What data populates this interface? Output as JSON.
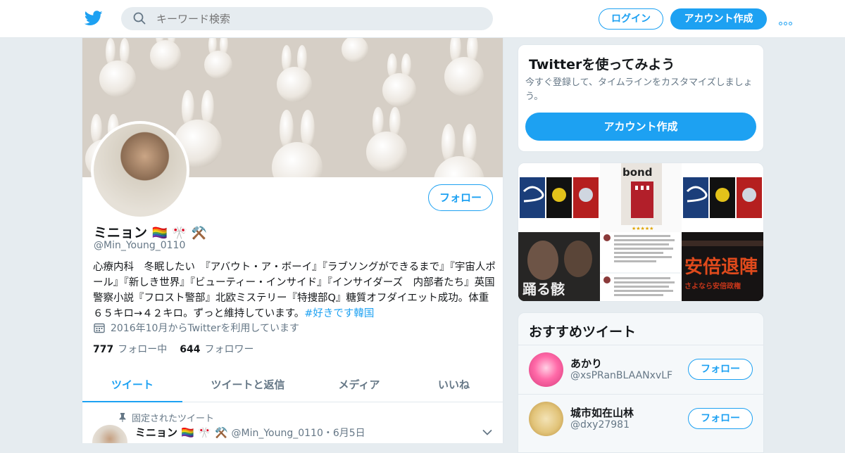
{
  "topbar": {
    "search_placeholder": "キーワード検索",
    "login_label": "ログイン",
    "signup_label": "アカウント作成"
  },
  "profile": {
    "display_name": "ミニョン",
    "name_emoji": "🏳️‍🌈 🎌 ⚒️",
    "handle": "@Min_Young_0110",
    "follow_label": "フォロー",
    "bio_text": "心療内科　冬眠したい　『アバウト・ア・ボーイ』『ラブソングができるまで』『宇宙人ポール』『新しき世界』『ビューティー・インサイド』『インサイダーズ　内部者たち』英国警察小説『フロスト警部』北欧ミステリー『特捜部Q』糖質オフダイエット成功。体重６５キロ→４２キロ。ずっと維持しています。",
    "bio_hashtag": "#好きです韓国",
    "joined": "2016年10月からTwitterを利用しています",
    "following_count": "777",
    "following_label": "フォロー中",
    "followers_count": "644",
    "followers_label": "フォロワー",
    "tabs": [
      {
        "label": "ツイート"
      },
      {
        "label": "ツイートと返信"
      },
      {
        "label": "メディア"
      },
      {
        "label": "いいね"
      }
    ],
    "pinned_label": "固定されたツイート",
    "pinned_tweet": {
      "name": "ミニョン 🏳️‍🌈 🎌 ⚒️",
      "meta": "@Min_Young_0110・6月5日"
    }
  },
  "try_card": {
    "title": "Twitterを使ってみよう",
    "description": "今すぐ登録して、タイムラインをカスタマイズしましょう。",
    "button_label": "アカウント作成"
  },
  "media": {
    "tile_texts": [
      "bond",
      "踊る骸",
      "安倍退陣",
      "さよなら安倍政権"
    ]
  },
  "recommended": {
    "title": "おすすめツイート",
    "follow_label": "フォロー",
    "accounts": [
      {
        "name": "あかり",
        "handle": "@xsPRanBLAANxvLF"
      },
      {
        "name": "城市如在山林",
        "handle": "@dxy27981"
      }
    ]
  },
  "colors": {
    "accent": "#1da1f2",
    "background": "#e6ecf0",
    "secondary_text": "#657786"
  }
}
